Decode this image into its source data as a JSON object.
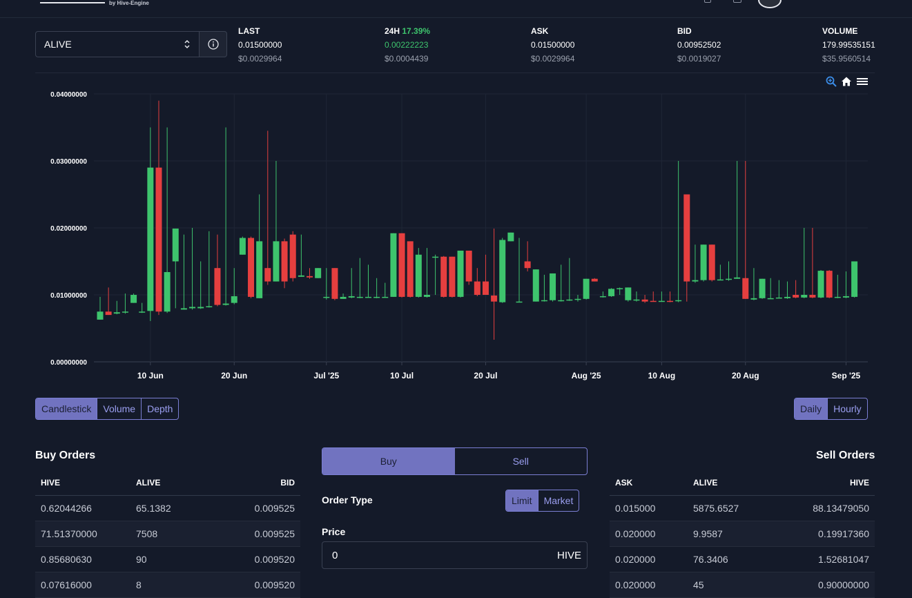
{
  "brand": {
    "sub": "by Hive-Engine"
  },
  "token": {
    "symbol": "ALIVE"
  },
  "stats": {
    "last": {
      "label": "LAST",
      "value": "0.01500000",
      "usd": "$0.0029964"
    },
    "change": {
      "label": "24H",
      "pct": "17.39%",
      "value": "0.00222223",
      "usd": "$0.0004439"
    },
    "ask": {
      "label": "ASK",
      "value": "0.01500000",
      "usd": "$0.0029964"
    },
    "bid": {
      "label": "BID",
      "value": "0.00952502",
      "usd": "$0.0019027"
    },
    "volume": {
      "label": "VOLUME",
      "value": "179.99535151",
      "usd": "$35.9560514"
    }
  },
  "colors": {
    "up": "#3ec46d",
    "down": "#e53f3f",
    "accent": "#7173c0",
    "bg": "#141a29"
  },
  "chart_tools": [
    "zoom-icon",
    "home-icon",
    "menu-icon"
  ],
  "chart_data": {
    "type": "candlestick",
    "y_ticks": [
      "0.00000000",
      "0.01000000",
      "0.02000000",
      "0.03000000",
      "0.04000000"
    ],
    "ylim": [
      0,
      0.04
    ],
    "x_ticks": [
      {
        "label": "10 Jun",
        "index": 6
      },
      {
        "label": "20 Jun",
        "index": 16
      },
      {
        "label": "Jul '25",
        "index": 27
      },
      {
        "label": "10 Jul",
        "index": 36
      },
      {
        "label": "20 Jul",
        "index": 46
      },
      {
        "label": "Aug '25",
        "index": 58
      },
      {
        "label": "10 Aug",
        "index": 67
      },
      {
        "label": "20 Aug",
        "index": 77
      },
      {
        "label": "Sep '25",
        "index": 89
      }
    ],
    "candles": [
      [
        0.0063,
        0.0075,
        0.0097,
        0.0063
      ],
      [
        0.0075,
        0.007,
        0.0111,
        0.007
      ],
      [
        0.0072,
        0.0074,
        0.0091,
        0.0071
      ],
      [
        0.0074,
        0.0075,
        0.0102,
        0.0072
      ],
      [
        0.0088,
        0.01,
        0.0102,
        0.0088
      ],
      [
        0.0074,
        0.0075,
        0.0088,
        0.0073
      ],
      [
        0.0076,
        0.029,
        0.035,
        0.0061
      ],
      [
        0.029,
        0.0075,
        0.039,
        0.007
      ],
      [
        0.0075,
        0.0134,
        0.035,
        0.0073
      ],
      [
        0.015,
        0.0199,
        0.0199,
        0.008
      ],
      [
        0.0078,
        0.008,
        0.019,
        0.0078
      ],
      [
        0.008,
        0.0082,
        0.02,
        0.0078
      ],
      [
        0.008,
        0.0082,
        0.015,
        0.0079
      ],
      [
        0.0082,
        0.0083,
        0.0195,
        0.0081
      ],
      [
        0.014,
        0.0085,
        0.019,
        0.0083
      ],
      [
        0.0085,
        0.0087,
        0.035,
        0.0084
      ],
      [
        0.0088,
        0.0098,
        0.014,
        0.0086
      ],
      [
        0.016,
        0.0185,
        0.0187,
        0.016
      ],
      [
        0.0185,
        0.0097,
        0.0187,
        0.0095
      ],
      [
        0.0095,
        0.018,
        0.025,
        0.0095
      ],
      [
        0.014,
        0.012,
        0.0345,
        0.0115
      ],
      [
        0.012,
        0.018,
        0.03,
        0.012
      ],
      [
        0.018,
        0.012,
        0.0184,
        0.011
      ],
      [
        0.019,
        0.0125,
        0.0195,
        0.012
      ],
      [
        0.0127,
        0.0129,
        0.019,
        0.0127
      ],
      [
        0.0128,
        0.0126,
        0.014,
        0.0124
      ],
      [
        0.0125,
        0.014,
        0.014,
        0.0125
      ],
      [
        0.0097,
        0.0097,
        0.014,
        0.0093
      ],
      [
        0.014,
        0.0094,
        0.014,
        0.0092
      ],
      [
        0.0094,
        0.0097,
        0.0102,
        0.0094
      ],
      [
        0.0096,
        0.0098,
        0.014,
        0.0095
      ],
      [
        0.0097,
        0.0097,
        0.0155,
        0.0095
      ],
      [
        0.0096,
        0.0097,
        0.0145,
        0.0096
      ],
      [
        0.0096,
        0.0097,
        0.0125,
        0.0095
      ],
      [
        0.0097,
        0.0097,
        0.0118,
        0.0096
      ],
      [
        0.0097,
        0.0192,
        0.0192,
        0.0097
      ],
      [
        0.0192,
        0.0097,
        0.0192,
        0.0096
      ],
      [
        0.018,
        0.0097,
        0.018,
        0.0096
      ],
      [
        0.0097,
        0.016,
        0.017,
        0.0096
      ],
      [
        0.0097,
        0.01,
        0.017,
        0.0096
      ],
      [
        0.0157,
        0.0157,
        0.016,
        0.01
      ],
      [
        0.0157,
        0.0097,
        0.0158,
        0.0096
      ],
      [
        0.0157,
        0.0097,
        0.0157,
        0.0096
      ],
      [
        0.0097,
        0.0166,
        0.0166,
        0.0096
      ],
      [
        0.0166,
        0.012,
        0.0166,
        0.0115
      ],
      [
        0.012,
        0.01,
        0.014,
        0.0098
      ],
      [
        0.012,
        0.01,
        0.016,
        0.01
      ],
      [
        0.0099,
        0.009,
        0.0199,
        0.0033
      ],
      [
        0.0089,
        0.0182,
        0.0185,
        0.0088
      ],
      [
        0.018,
        0.0193,
        0.0193,
        0.018
      ],
      [
        0.009,
        0.009,
        0.0185,
        0.0089
      ],
      [
        0.015,
        0.014,
        0.018,
        0.0135
      ],
      [
        0.009,
        0.0138,
        0.0138,
        0.009
      ],
      [
        0.0091,
        0.0092,
        0.013,
        0.009
      ],
      [
        0.0092,
        0.0132,
        0.0132,
        0.009
      ],
      [
        0.0091,
        0.0092,
        0.0145,
        0.009
      ],
      [
        0.0092,
        0.0093,
        0.0155,
        0.0091
      ],
      [
        0.0093,
        0.0094,
        0.01,
        0.009
      ],
      [
        0.0094,
        0.0124,
        0.0124,
        0.0093
      ],
      [
        0.0124,
        0.012,
        0.0125,
        0.012
      ],
      [
        0.0097,
        0.0098,
        0.0105,
        0.0096
      ],
      [
        0.0098,
        0.0109,
        0.011,
        0.0097
      ],
      [
        0.0109,
        0.011,
        0.0111,
        0.01
      ],
      [
        0.0092,
        0.0111,
        0.0111,
        0.009
      ],
      [
        0.0092,
        0.0093,
        0.0105,
        0.009
      ],
      [
        0.0093,
        0.009,
        0.01,
        0.0088
      ],
      [
        0.0091,
        0.009,
        0.0105,
        0.009
      ],
      [
        0.0091,
        0.0091,
        0.0105,
        0.009
      ],
      [
        0.0091,
        0.009,
        0.0105,
        0.0089
      ],
      [
        0.0091,
        0.0092,
        0.03,
        0.0089
      ],
      [
        0.025,
        0.012,
        0.025,
        0.009
      ],
      [
        0.012,
        0.0122,
        0.0175,
        0.0118
      ],
      [
        0.0122,
        0.0175,
        0.0175,
        0.012
      ],
      [
        0.0175,
        0.0122,
        0.0175,
        0.012
      ],
      [
        0.0122,
        0.0123,
        0.0145,
        0.0122
      ],
      [
        0.0123,
        0.0124,
        0.015,
        0.0121
      ],
      [
        0.0124,
        0.0126,
        0.03,
        0.0124
      ],
      [
        0.0125,
        0.0094,
        0.03,
        0.0094
      ],
      [
        0.0093,
        0.0095,
        0.014,
        0.0092
      ],
      [
        0.0095,
        0.0124,
        0.0124,
        0.0094
      ],
      [
        0.0094,
        0.0095,
        0.0125,
        0.0094
      ],
      [
        0.0095,
        0.0096,
        0.0122,
        0.0095
      ],
      [
        0.0095,
        0.0097,
        0.012,
        0.0094
      ],
      [
        0.01,
        0.0096,
        0.0122,
        0.0095
      ],
      [
        0.0096,
        0.01,
        0.02,
        0.0095
      ],
      [
        0.01,
        0.0096,
        0.02,
        0.0095
      ],
      [
        0.0096,
        0.0136,
        0.0137,
        0.0095
      ],
      [
        0.0136,
        0.0096,
        0.0137,
        0.0095
      ],
      [
        0.0096,
        0.0097,
        0.013,
        0.0095
      ],
      [
        0.0096,
        0.0098,
        0.0135,
        0.0095
      ],
      [
        0.0097,
        0.015,
        0.015,
        0.0096
      ]
    ]
  },
  "chart_type_buttons": [
    "Candlestick",
    "Volume",
    "Depth"
  ],
  "interval_buttons": [
    "Daily",
    "Hourly"
  ],
  "buy_orders": {
    "title": "Buy Orders",
    "headers": [
      "HIVE",
      "ALIVE",
      "BID"
    ],
    "rows": [
      [
        "0.62044266",
        "65.1382",
        "0.009525"
      ],
      [
        "71.51370000",
        "7508",
        "0.009525"
      ],
      [
        "0.85680630",
        "90",
        "0.009520"
      ],
      [
        "0.07616000",
        "8",
        "0.009520"
      ]
    ]
  },
  "sell_orders": {
    "title": "Sell Orders",
    "headers": [
      "ASK",
      "ALIVE",
      "HIVE"
    ],
    "rows": [
      [
        "0.015000",
        "5875.6527",
        "88.13479050"
      ],
      [
        "0.020000",
        "9.9587",
        "0.19917360"
      ],
      [
        "0.020000",
        "76.3406",
        "1.52681047"
      ],
      [
        "0.020000",
        "45",
        "0.90000000"
      ]
    ]
  },
  "trade": {
    "tabs": [
      "Buy",
      "Sell"
    ],
    "order_type_label": "Order Type",
    "order_types": [
      "Limit",
      "Market"
    ],
    "price_label": "Price",
    "price_value": "0",
    "price_unit": "HIVE"
  }
}
